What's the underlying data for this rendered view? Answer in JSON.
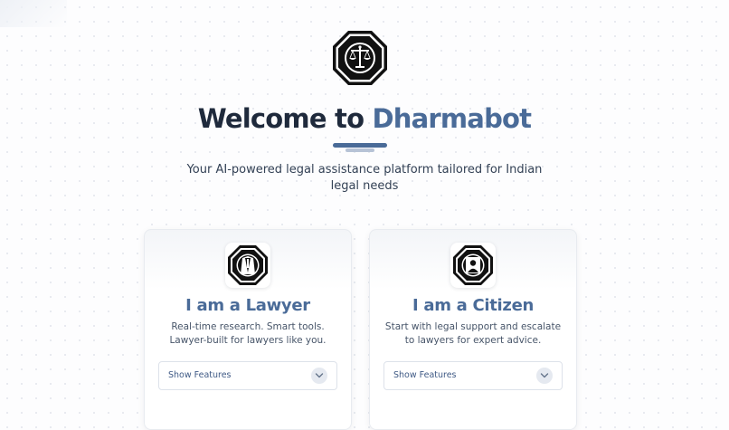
{
  "hero": {
    "title_prefix": "Welcome to",
    "title_brand": "Dharmabot",
    "subtitle": "Your AI-powered legal assistance platform tailored for Indian legal needs",
    "logo_icon": "scales-of-justice-octagon-icon"
  },
  "cards": [
    {
      "title": "I am a Lawyer",
      "description": "Real-time research. Smart tools. Lawyer-built for lawyers like you.",
      "icon": "lawyer-gown-octagon-icon",
      "features_label": "Show Features"
    },
    {
      "title": "I am a Citizen",
      "description": "Start with legal support and escalate to lawyers for expert advice.",
      "icon": "citizen-person-octagon-icon",
      "features_label": "Show Features"
    }
  ],
  "colors": {
    "brand": "#4a6b98",
    "title_dark": "#1f2a3c",
    "underline_light": "#b7c3d6"
  }
}
